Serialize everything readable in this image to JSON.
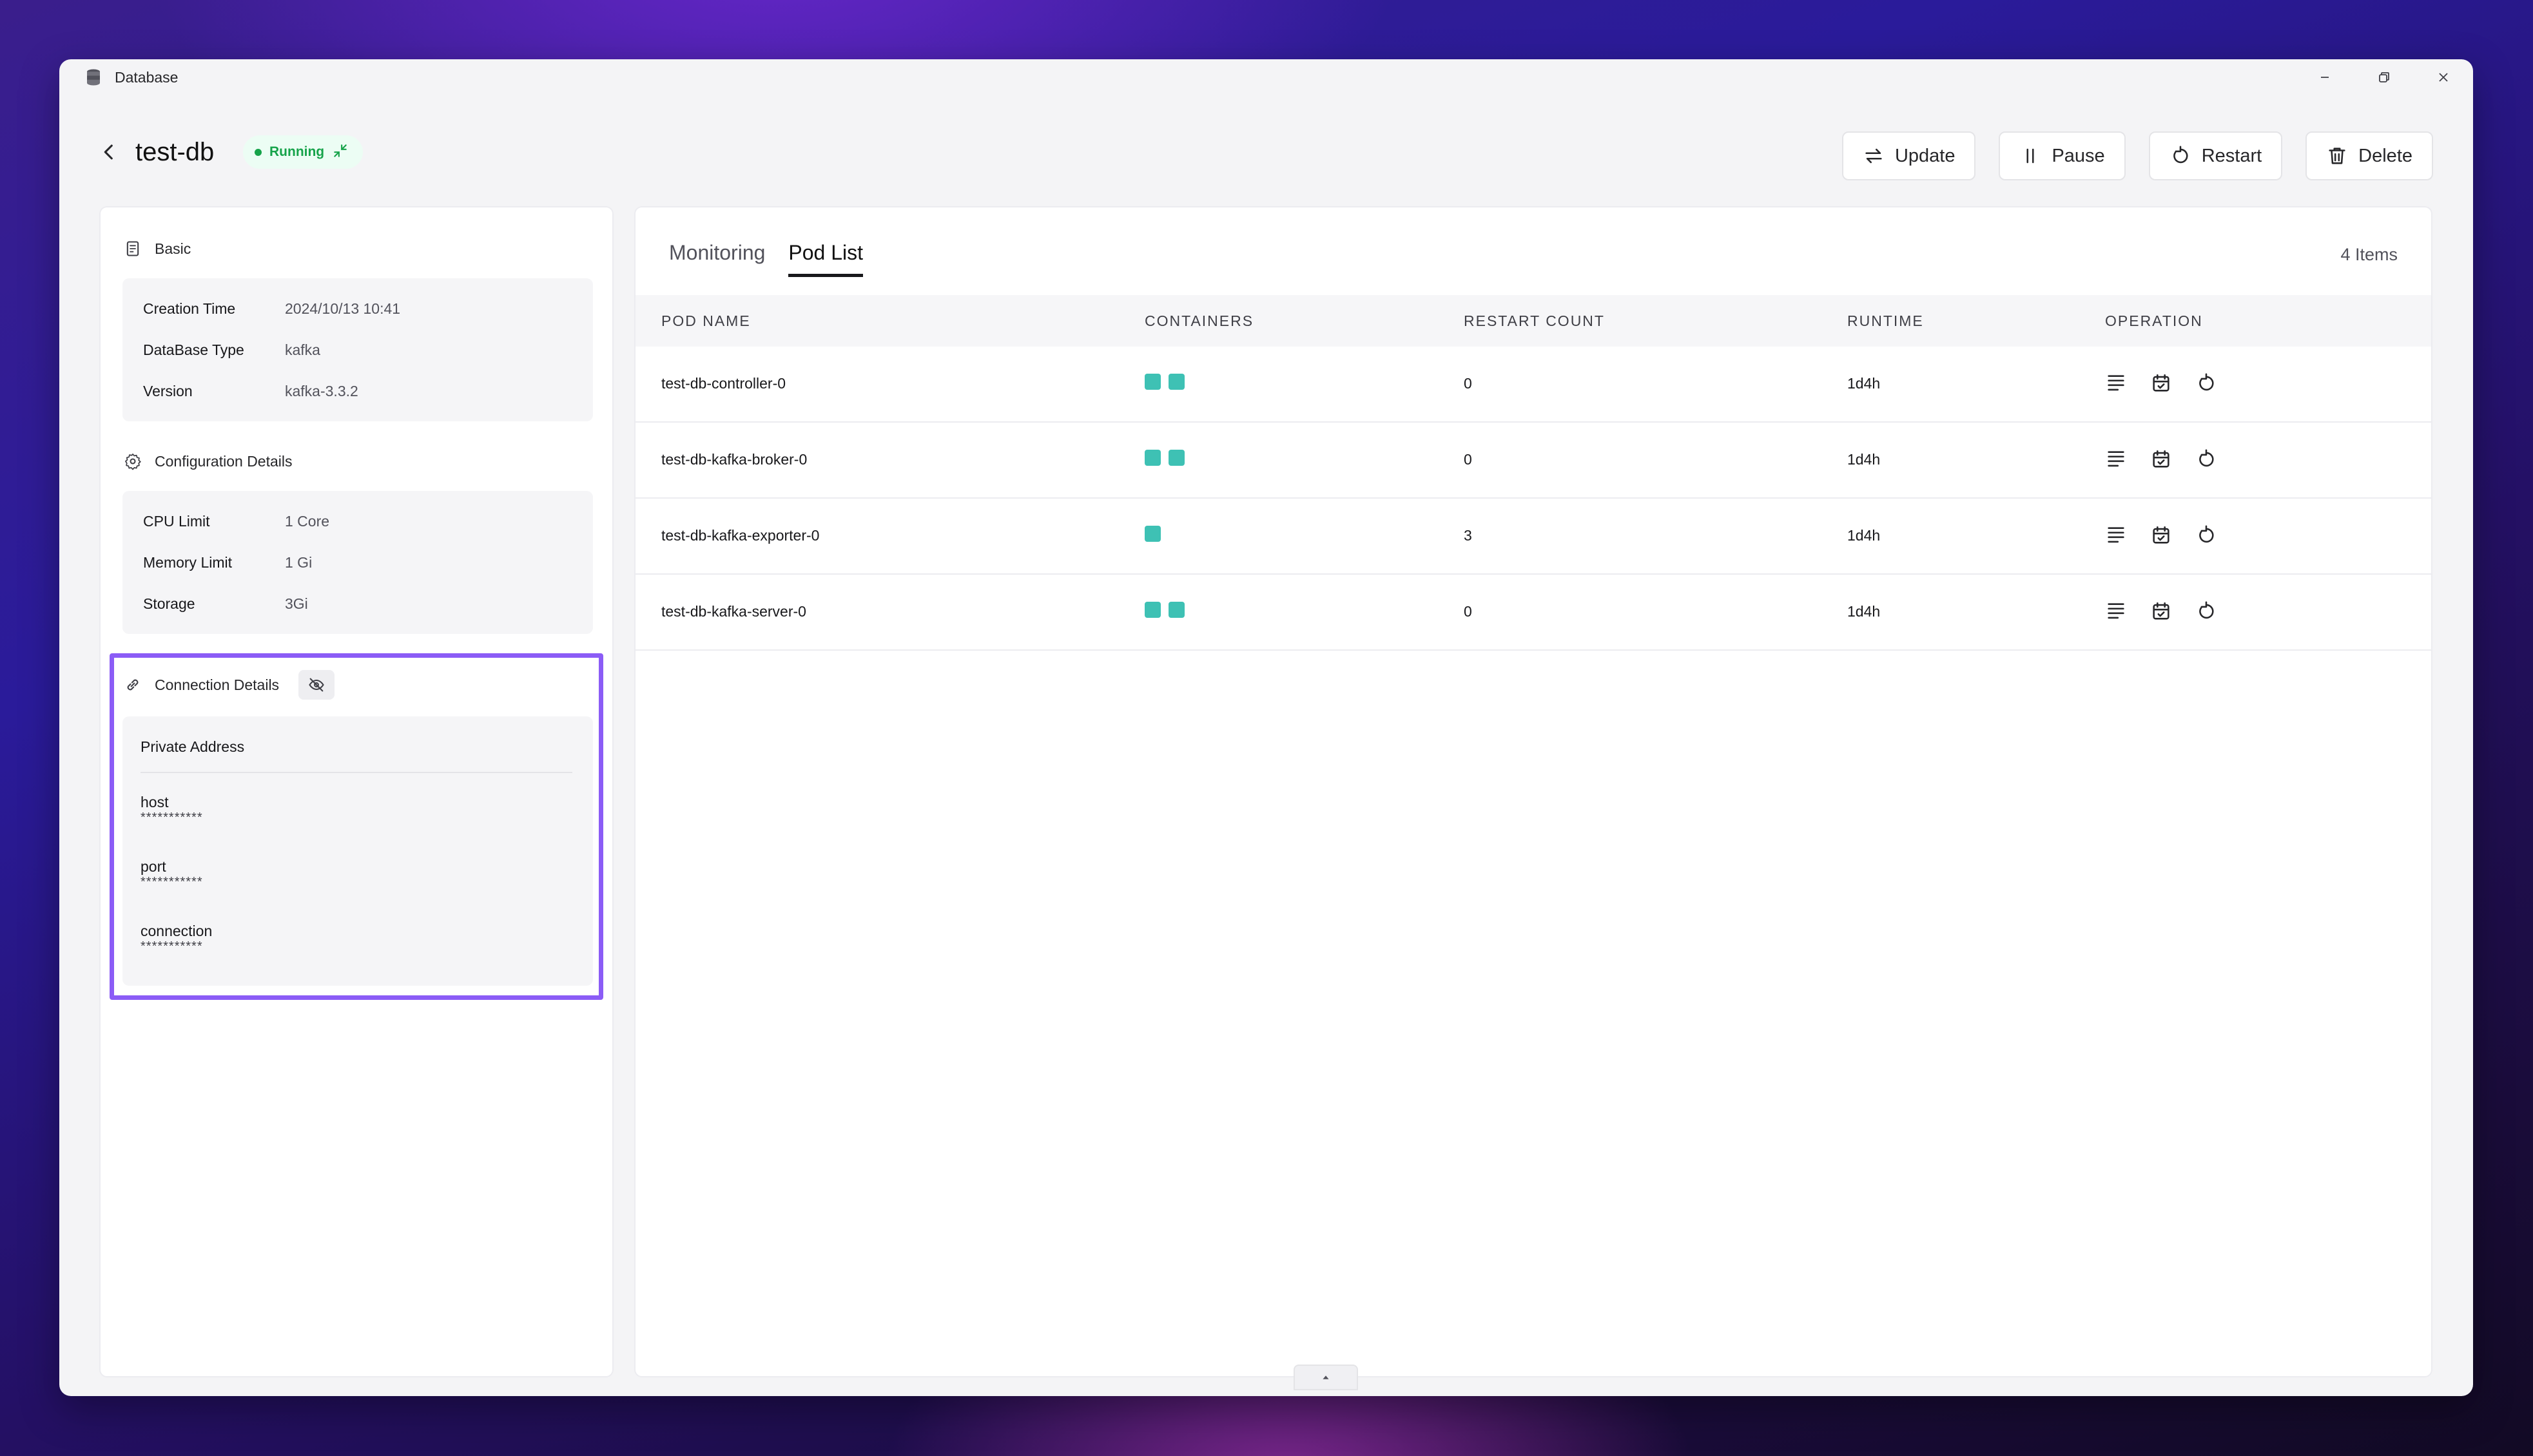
{
  "window": {
    "title": "Database",
    "app_icon": "database-icon"
  },
  "header": {
    "title": "test-db",
    "status": {
      "label": "Running",
      "color": "#16a34a"
    },
    "actions": [
      {
        "label": "Update",
        "icon": "swap-icon"
      },
      {
        "label": "Pause",
        "icon": "pause-icon"
      },
      {
        "label": "Restart",
        "icon": "restart-icon"
      },
      {
        "label": "Delete",
        "icon": "trash-icon"
      }
    ]
  },
  "basic": {
    "title": "Basic",
    "items": [
      {
        "key": "Creation Time",
        "value": "2024/10/13 10:41"
      },
      {
        "key": "DataBase Type",
        "value": "kafka"
      },
      {
        "key": "Version",
        "value": "kafka-3.3.2"
      }
    ]
  },
  "config": {
    "title": "Configuration Details",
    "items": [
      {
        "key": "CPU Limit",
        "value": "1 Core"
      },
      {
        "key": "Memory Limit",
        "value": "1 Gi"
      },
      {
        "key": "Storage",
        "value": "3Gi"
      }
    ]
  },
  "connection": {
    "title": "Connection Details",
    "section_label": "Private Address",
    "fields": [
      {
        "label": "host",
        "value": "***********"
      },
      {
        "label": "port",
        "value": "***********"
      },
      {
        "label": "connection",
        "value": "***********"
      }
    ],
    "highlight_color": "#8b5cf6"
  },
  "pods": {
    "tabs": [
      {
        "label": "Monitoring"
      },
      {
        "label": "Pod List"
      }
    ],
    "active_tab": "Pod List",
    "count_label": "4 Items",
    "columns": [
      "POD NAME",
      "CONTAINERS",
      "RESTART COUNT",
      "RUNTIME",
      "OPERATION"
    ],
    "rows": [
      {
        "name": "test-db-controller-0",
        "containers": 2,
        "restart_count": "0",
        "runtime": "1d4h"
      },
      {
        "name": "test-db-kafka-broker-0",
        "containers": 2,
        "restart_count": "0",
        "runtime": "1d4h"
      },
      {
        "name": "test-db-kafka-exporter-0",
        "containers": 1,
        "restart_count": "3",
        "runtime": "1d4h"
      },
      {
        "name": "test-db-kafka-server-0",
        "containers": 2,
        "restart_count": "0",
        "runtime": "1d4h"
      }
    ],
    "container_color": "#3ec1b4"
  }
}
